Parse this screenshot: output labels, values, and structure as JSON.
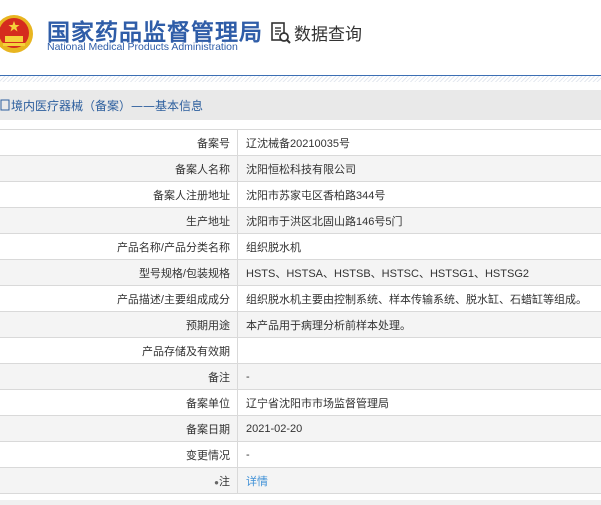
{
  "header": {
    "title_cn": "国家药品监督管理局",
    "title_en": "National Medical Products Administration",
    "query_label": "数据查询",
    "brand_color": "#2f5da8"
  },
  "section": {
    "title": "境内医疗器械（备案）——基本信息"
  },
  "rows": [
    {
      "label": "备案号",
      "value": "辽沈械备20210035号"
    },
    {
      "label": "备案人名称",
      "value": "沈阳恒松科技有限公司"
    },
    {
      "label": "备案人注册地址",
      "value": "沈阳市苏家屯区香柏路344号"
    },
    {
      "label": "生产地址",
      "value": "沈阳市于洪区北固山路146号5门"
    },
    {
      "label": "产品名称/产品分类名称",
      "value": "组织脱水机"
    },
    {
      "label": "型号规格/包装规格",
      "value": "HSTS、HSTSA、HSTSB、HSTSC、HSTSG1、HSTSG2"
    },
    {
      "label": "产品描述/主要组成成分",
      "value": "组织脱水机主要由控制系统、样本传输系统、脱水缸、石蜡缸等组成。"
    },
    {
      "label": "预期用途",
      "value": "本产品用于病理分析前样本处理。"
    },
    {
      "label": "产品存储及有效期",
      "value": ""
    },
    {
      "label": "备注",
      "value": "-"
    },
    {
      "label": "备案单位",
      "value": "辽宁省沈阳市市场监督管理局"
    },
    {
      "label": "备案日期",
      "value": "2021-02-20"
    },
    {
      "label": "变更情况",
      "value": "-"
    },
    {
      "label": "注",
      "value": "详情"
    }
  ]
}
